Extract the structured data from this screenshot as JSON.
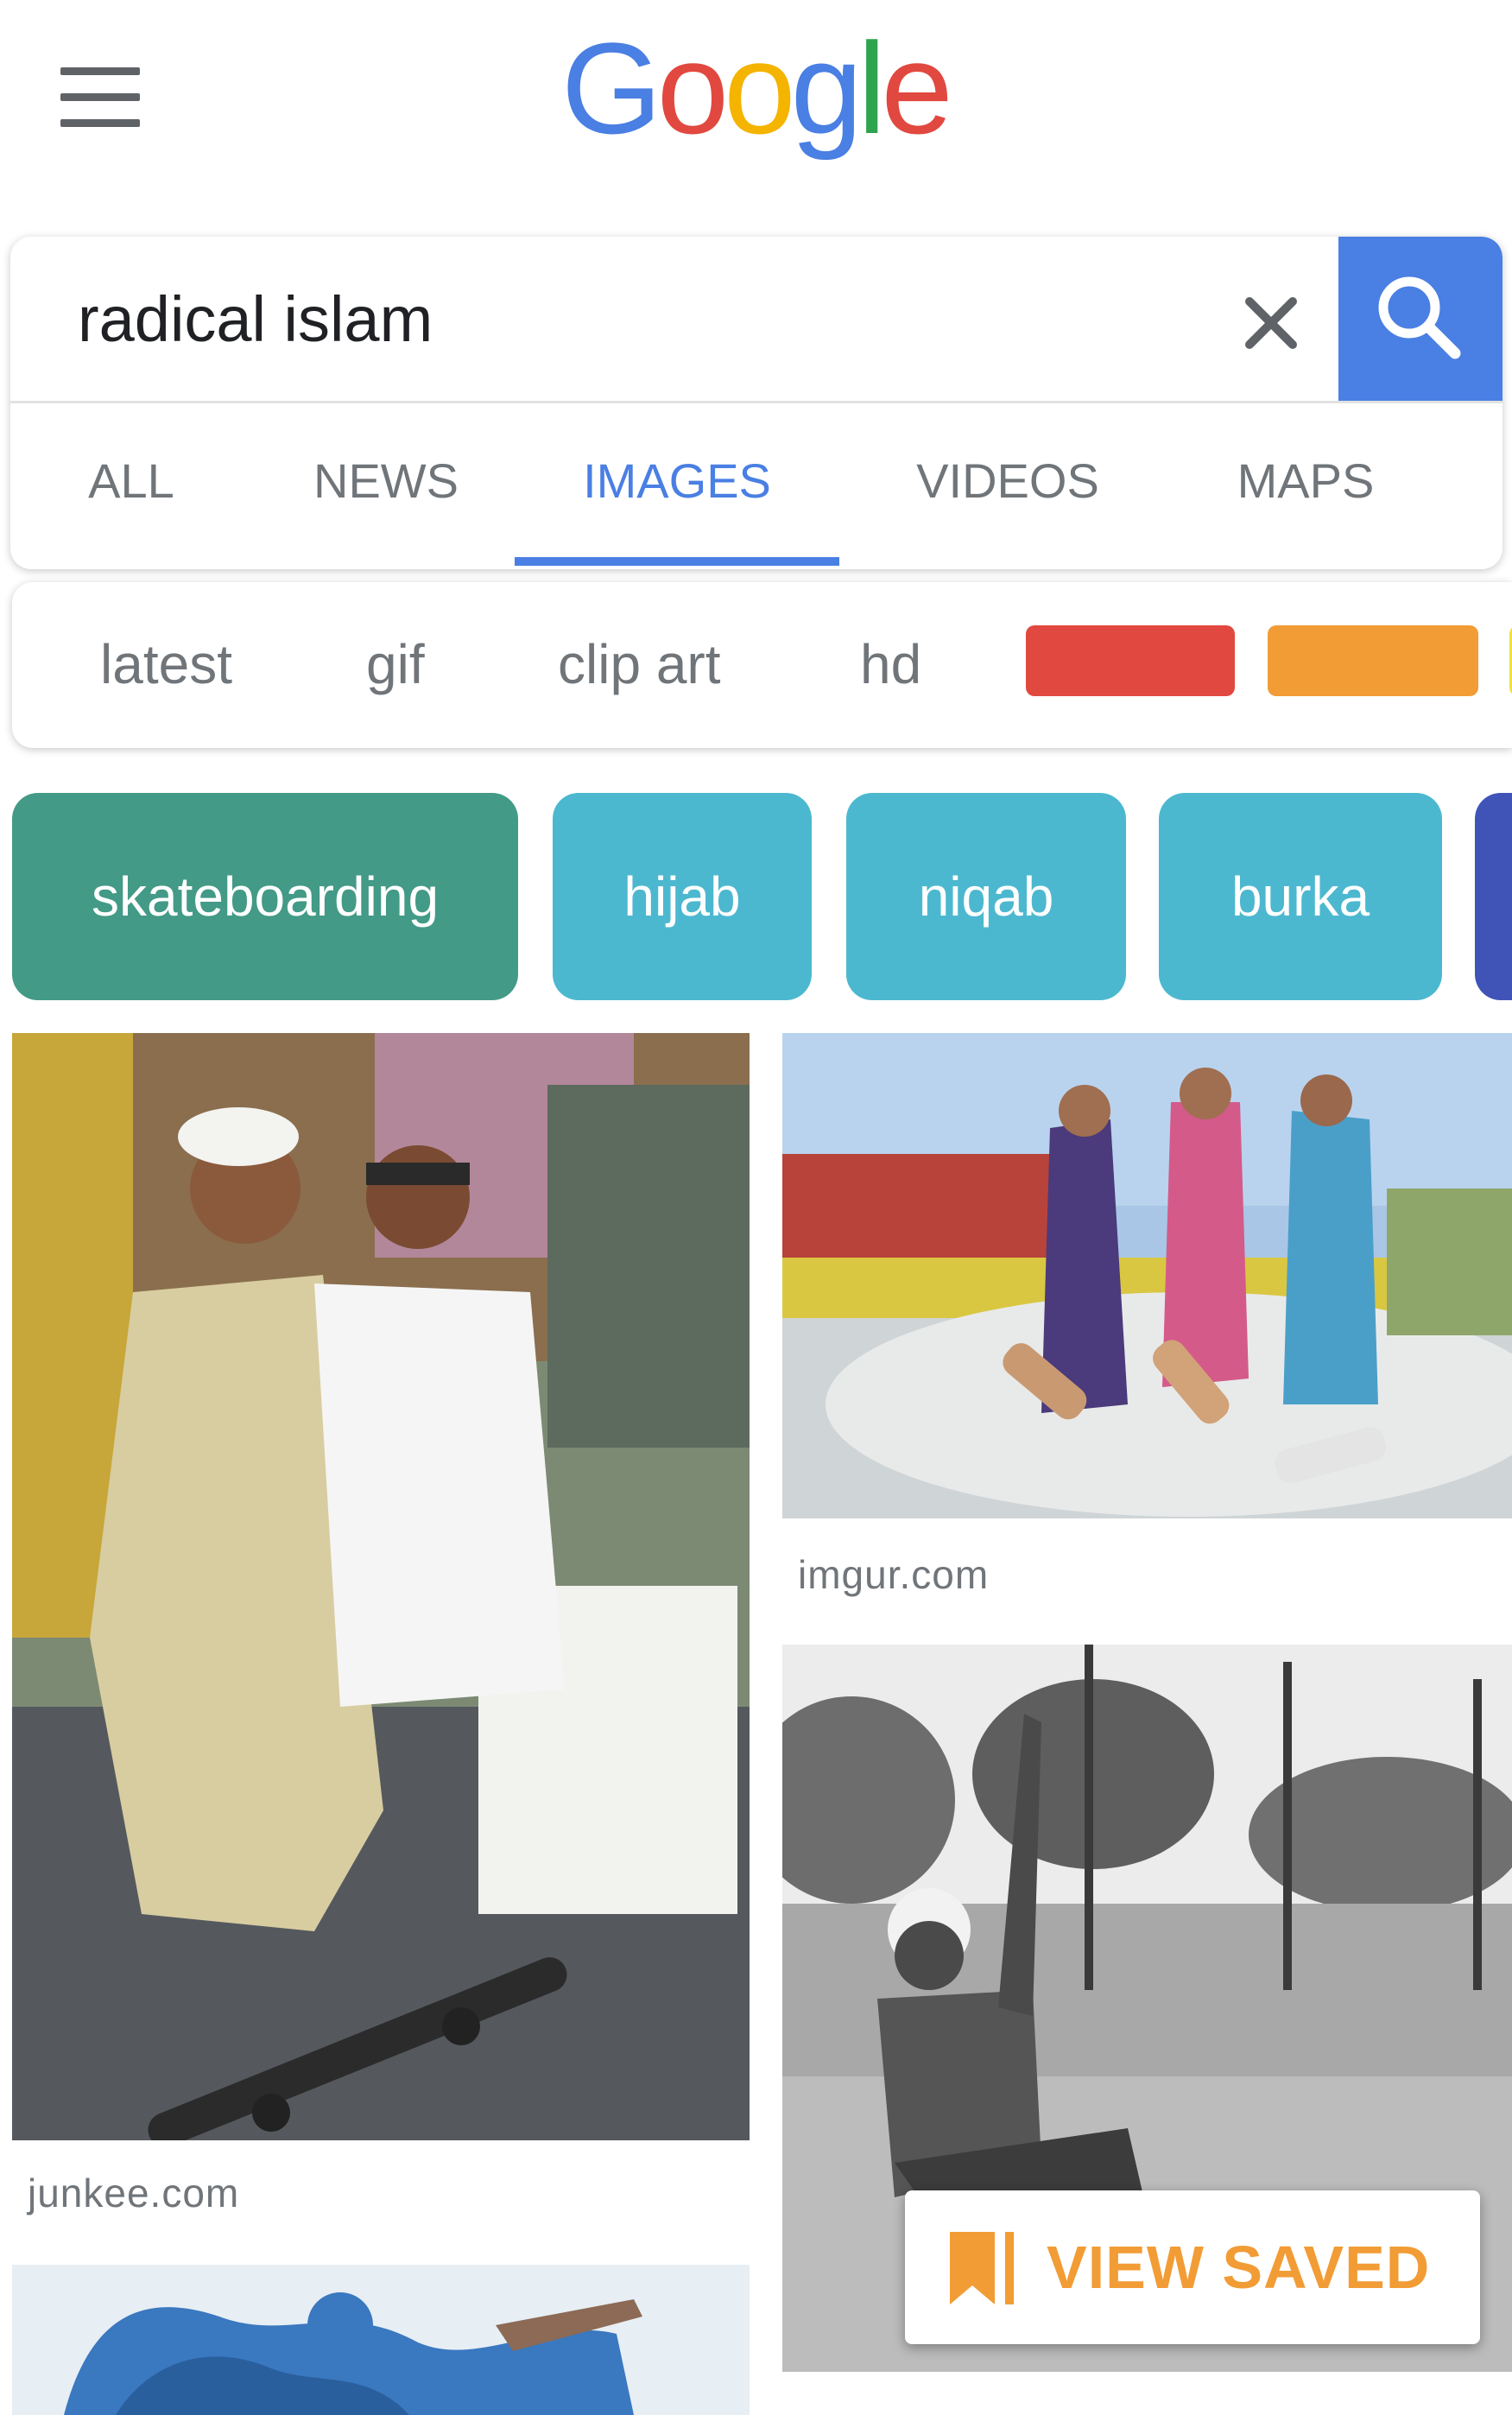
{
  "header": {
    "logo_text": "Google",
    "menu_icon": "hamburger-menu-icon"
  },
  "search": {
    "query": "radical islam",
    "clear_icon": "close-icon",
    "submit_icon": "search-icon"
  },
  "tabs": [
    {
      "label": "ALL",
      "active": false
    },
    {
      "label": "NEWS",
      "active": false
    },
    {
      "label": "IMAGES",
      "active": true
    },
    {
      "label": "VIDEOS",
      "active": false
    },
    {
      "label": "MAPS",
      "active": false
    }
  ],
  "filters": {
    "chips": [
      "latest",
      "gif",
      "clip art",
      "hd"
    ],
    "color_swatches": [
      "#e1483f",
      "#f29c36",
      "#f3e03b"
    ]
  },
  "related": [
    {
      "label": "skateboarding",
      "color": "#439a86"
    },
    {
      "label": "hijab",
      "color": "#4cb8cf"
    },
    {
      "label": "niqab",
      "color": "#4cb8cf"
    },
    {
      "label": "burka",
      "color": "#4cb8cf"
    },
    {
      "label": "",
      "color": "#4054b8"
    }
  ],
  "results": [
    {
      "source": "junkee.com"
    },
    {
      "source": "imgur.com"
    },
    {
      "source": ""
    },
    {
      "source": ""
    }
  ],
  "view_saved": {
    "label": "VIEW SAVED",
    "icon": "bookmark-icon",
    "color": "#f29c36"
  },
  "colors": {
    "accent_blue": "#4a7fe3",
    "text_gray": "#70757a"
  }
}
